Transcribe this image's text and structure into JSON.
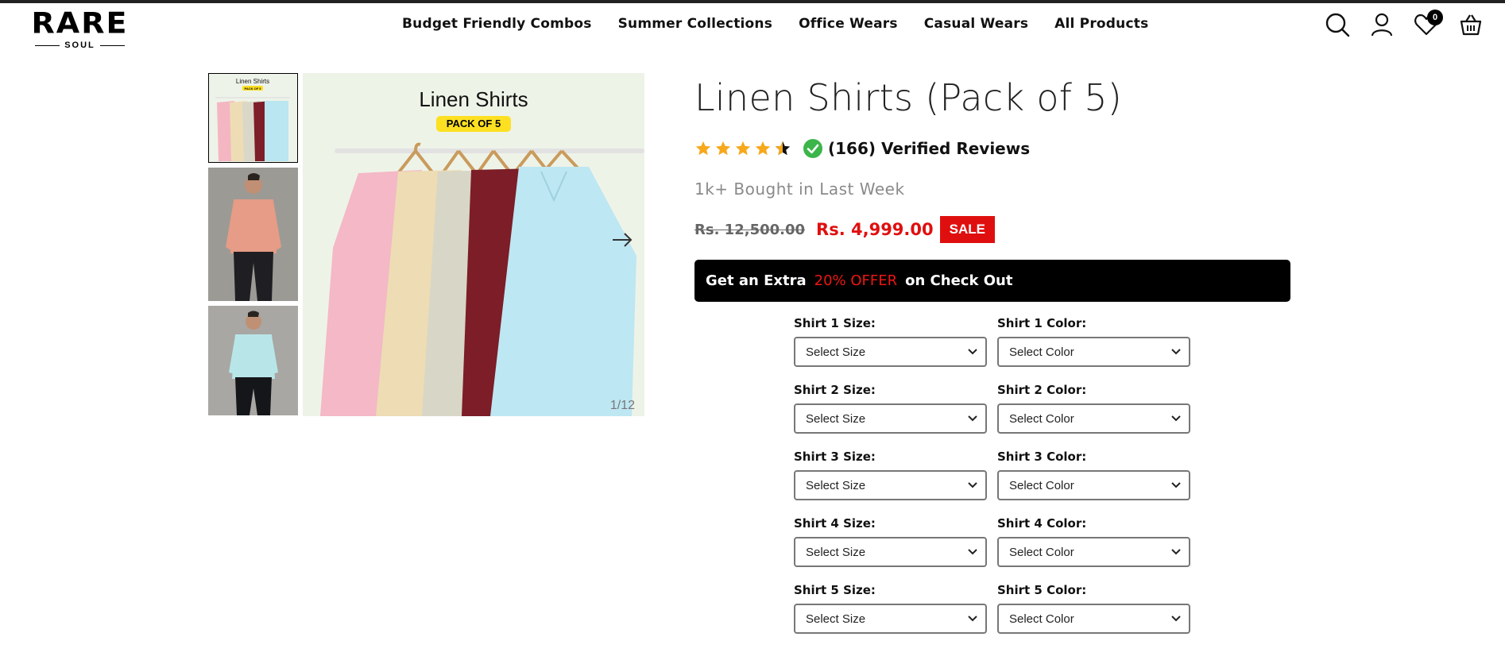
{
  "header": {
    "logo_text": "RARE",
    "logo_sub": "SOUL",
    "nav": [
      {
        "label": "Budget Friendly Combos"
      },
      {
        "label": "Summer Collections"
      },
      {
        "label": "Office Wears"
      },
      {
        "label": "Casual Wears"
      },
      {
        "label": "All Products"
      }
    ],
    "wishlist_count": "0",
    "icons": [
      "search-icon",
      "user-icon",
      "heart-icon",
      "basket-icon"
    ]
  },
  "gallery": {
    "main_title": "Linen Shirts",
    "main_badge": "PACK OF 5",
    "thumb1_title": "Linen Shirts",
    "thumb1_badge": "PACK OF 5",
    "counter": "1/12"
  },
  "product": {
    "title": "Linen Shirts (Pack of 5)",
    "rating": 4.5,
    "reviews_text": "(166) Verified Reviews",
    "bought_text": "1k+ Bought in Last Week",
    "old_price": "Rs. 12,500.00",
    "new_price": "Rs. 4,999.00",
    "sale_label": "SALE"
  },
  "offer": {
    "prefix": "Get an Extra",
    "highlight": "20% OFFER",
    "suffix": "on Check Out"
  },
  "options": [
    {
      "size_label": "Shirt 1 Size:",
      "size_value": "Select Size",
      "color_label": "Shirt 1 Color:",
      "color_value": "Select Color"
    },
    {
      "size_label": "Shirt 2 Size:",
      "size_value": "Select Size",
      "color_label": "Shirt 2 Color:",
      "color_value": "Select Color"
    },
    {
      "size_label": "Shirt 3 Size:",
      "size_value": "Select Size",
      "color_label": "Shirt 3 Color:",
      "color_value": "Select Color"
    },
    {
      "size_label": "Shirt 4 Size:",
      "size_value": "Select Size",
      "color_label": "Shirt 4 Color:",
      "color_value": "Select Color"
    },
    {
      "size_label": "Shirt 5 Size:",
      "size_value": "Select Size",
      "color_label": "Shirt 5 Color:",
      "color_value": "Select Color"
    }
  ],
  "colors": {
    "accent_red": "#e00f0f",
    "star": "#f7a81b",
    "verified_green": "#3cb54a",
    "pack_badge": "#fde021"
  }
}
